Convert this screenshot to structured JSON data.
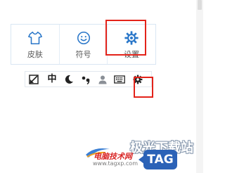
{
  "panel": {
    "items": [
      {
        "icon": "shirt-icon",
        "label": "皮肤"
      },
      {
        "icon": "smiley-icon",
        "label": "符号"
      },
      {
        "icon": "gear-icon",
        "label": "设置"
      }
    ]
  },
  "toolbar": {
    "items": [
      {
        "icon": "edit-square-icon"
      },
      {
        "icon": "chinese-mode-icon",
        "text": "中"
      },
      {
        "icon": "moon-icon"
      },
      {
        "icon": "punctuation-icon"
      },
      {
        "icon": "user-icon"
      },
      {
        "icon": "keyboard-icon"
      },
      {
        "icon": "gear-icon"
      }
    ]
  },
  "watermark": {
    "brand": "极光下载站",
    "site_name": "电脑技术网",
    "url": "www.tagxp.com",
    "badge": "TAG"
  },
  "colors": {
    "accent_blue": "#2a77c9",
    "highlight_red": "#e3231a",
    "panel_border": "#d9e6f3"
  }
}
